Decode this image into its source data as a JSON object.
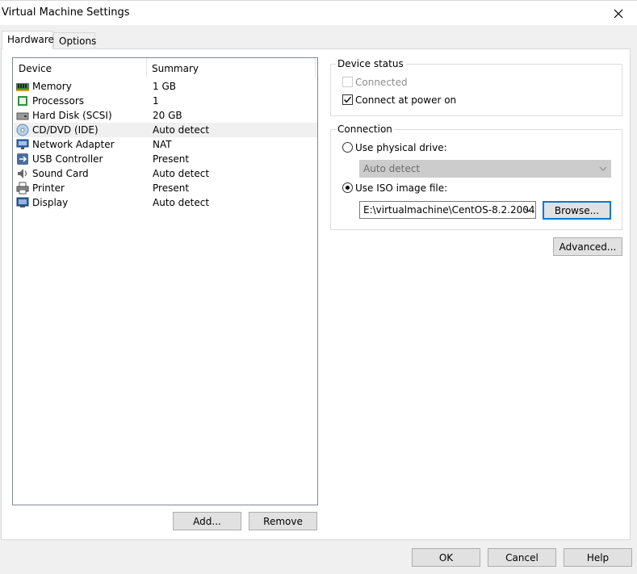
{
  "window": {
    "title": "Virtual Machine Settings"
  },
  "tabs": [
    {
      "label": "Hardware",
      "active": true
    },
    {
      "label": "Options",
      "active": false
    }
  ],
  "device_list": {
    "columns": [
      "Device",
      "Summary"
    ],
    "rows": [
      {
        "name": "Memory",
        "summary": "1 GB",
        "icon": "memory-icon"
      },
      {
        "name": "Processors",
        "summary": "1",
        "icon": "processor-icon"
      },
      {
        "name": "Hard Disk (SCSI)",
        "summary": "20 GB",
        "icon": "hard-disk-icon"
      },
      {
        "name": "CD/DVD (IDE)",
        "summary": "Auto detect",
        "icon": "cd-dvd-icon",
        "selected": true
      },
      {
        "name": "Network Adapter",
        "summary": "NAT",
        "icon": "network-adapter-icon"
      },
      {
        "name": "USB Controller",
        "summary": "Present",
        "icon": "usb-icon"
      },
      {
        "name": "Sound Card",
        "summary": "Auto detect",
        "icon": "sound-card-icon"
      },
      {
        "name": "Printer",
        "summary": "Present",
        "icon": "printer-icon"
      },
      {
        "name": "Display",
        "summary": "Auto detect",
        "icon": "display-icon"
      }
    ]
  },
  "list_buttons": {
    "add": "Add...",
    "remove": "Remove"
  },
  "device_status": {
    "legend": "Device status",
    "connected": {
      "label": "Connected",
      "checked": false,
      "enabled": false
    },
    "connect_at_power_on": {
      "label": "Connect at power on",
      "checked": true,
      "enabled": true
    }
  },
  "connection": {
    "legend": "Connection",
    "physical": {
      "label": "Use physical drive:",
      "selected": false
    },
    "physical_value": "Auto detect",
    "iso": {
      "label": "Use ISO image file:",
      "selected": true
    },
    "iso_path": "E:\\virtualmachine\\CentOS-8.2.2004",
    "browse": "Browse..."
  },
  "advanced": "Advanced...",
  "footer": {
    "ok": "OK",
    "cancel": "Cancel",
    "help": "Help"
  },
  "colors": {
    "selection": "#f0f0f0",
    "focus": "#0078d7",
    "button": "#e1e1e1"
  }
}
